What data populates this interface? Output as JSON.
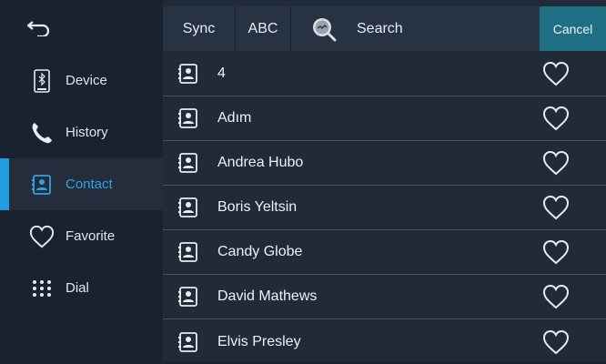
{
  "sidebar": {
    "back_icon": "back-arrow-icon",
    "items": [
      {
        "label": "Device",
        "icon": "bluetooth-phone-icon",
        "active": false
      },
      {
        "label": "History",
        "icon": "phone-handset-icon",
        "active": false
      },
      {
        "label": "Contact",
        "icon": "contact-book-icon",
        "active": true
      },
      {
        "label": "Favorite",
        "icon": "heart-icon",
        "active": false
      },
      {
        "label": "Dial",
        "icon": "dialpad-icon",
        "active": false
      }
    ]
  },
  "toolbar": {
    "sync_label": "Sync",
    "abc_label": "ABC",
    "search_label": "Search",
    "cancel_label": "Cancel"
  },
  "contacts": [
    {
      "name": "4"
    },
    {
      "name": "Adım"
    },
    {
      "name": "Andrea Hubo"
    },
    {
      "name": "Boris Yeltsin"
    },
    {
      "name": "Candy Globe"
    },
    {
      "name": "David Mathews"
    },
    {
      "name": "Elvis Presley"
    }
  ],
  "colors": {
    "accent": "#1e9ee0",
    "cancel_bg": "#1f6f84",
    "background": "#1c2430"
  }
}
